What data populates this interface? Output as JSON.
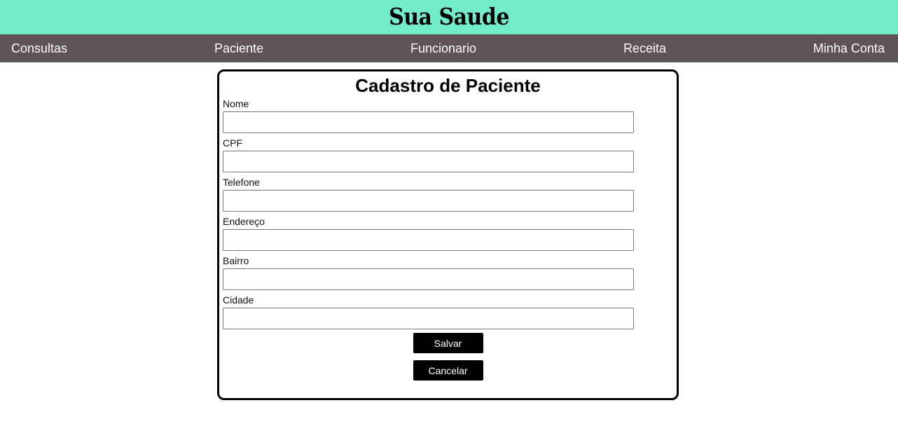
{
  "header": {
    "title": "Sua Saude"
  },
  "nav": {
    "items": [
      {
        "label": "Consultas"
      },
      {
        "label": "Paciente"
      },
      {
        "label": "Funcionario"
      },
      {
        "label": "Receita"
      },
      {
        "label": "Minha Conta"
      }
    ]
  },
  "form": {
    "title": "Cadastro de Paciente",
    "fields": [
      {
        "label": "Nome",
        "value": "",
        "placeholder": ""
      },
      {
        "label": "CPF",
        "value": "",
        "placeholder": ""
      },
      {
        "label": "Telefone",
        "value": "",
        "placeholder": ""
      },
      {
        "label": "Endereço",
        "value": "",
        "placeholder": ""
      },
      {
        "label": "Bairro",
        "value": "",
        "placeholder": ""
      },
      {
        "label": "Cidade",
        "value": "",
        "placeholder": ""
      }
    ],
    "save_label": "Salvar",
    "cancel_label": "Cancelar"
  },
  "colors": {
    "header_bg": "#72ecc9",
    "nav_bg": "#5e5455",
    "button_bg": "#000000"
  }
}
